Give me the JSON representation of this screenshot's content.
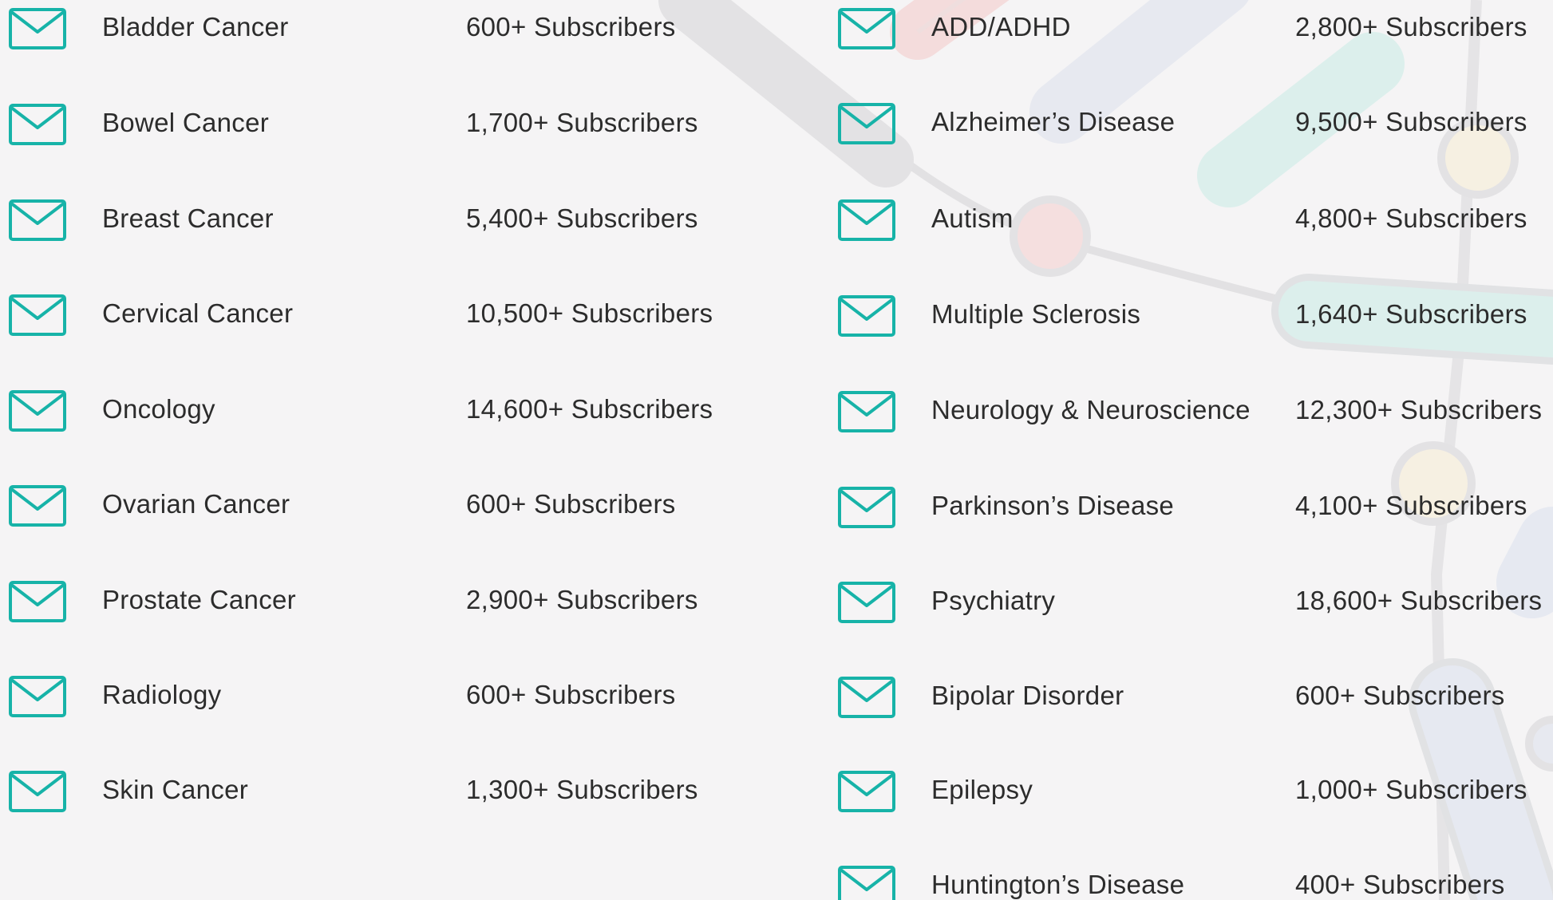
{
  "colors": {
    "background": "#f5f4f5",
    "icon_accent": "#17b3a8",
    "text": "#2c2c2c"
  },
  "icon_name": "envelope-icon",
  "left_column": [
    {
      "topic": "Bladder Cancer",
      "subscribers": "600+ Subscribers"
    },
    {
      "topic": "Bowel Cancer",
      "subscribers": "1,700+ Subscribers"
    },
    {
      "topic": "Breast Cancer",
      "subscribers": "5,400+ Subscribers"
    },
    {
      "topic": "Cervical Cancer",
      "subscribers": "10,500+ Subscribers"
    },
    {
      "topic": "Oncology",
      "subscribers": "14,600+ Subscribers"
    },
    {
      "topic": "Ovarian Cancer",
      "subscribers": "600+ Subscribers"
    },
    {
      "topic": "Prostate Cancer",
      "subscribers": "2,900+ Subscribers"
    },
    {
      "topic": "Radiology",
      "subscribers": "600+ Subscribers"
    },
    {
      "topic": "Skin Cancer",
      "subscribers": "1,300+ Subscribers"
    }
  ],
  "right_column": [
    {
      "topic": "ADD/ADHD",
      "subscribers": "2,800+ Subscribers"
    },
    {
      "topic": "Alzheimer’s Disease",
      "subscribers": "9,500+ Subscribers"
    },
    {
      "topic": "Autism",
      "subscribers": "4,800+ Subscribers"
    },
    {
      "topic": "Multiple Sclerosis",
      "subscribers": "1,640+ Subscribers"
    },
    {
      "topic": "Neurology & Neuroscience",
      "subscribers": "12,300+ Subscribers"
    },
    {
      "topic": "Parkinson’s Disease",
      "subscribers": "4,100+ Subscribers"
    },
    {
      "topic": "Psychiatry",
      "subscribers": "18,600+ Subscribers"
    },
    {
      "topic": "Bipolar Disorder",
      "subscribers": "600+ Subscribers"
    },
    {
      "topic": "Epilepsy",
      "subscribers": "1,000+ Subscribers"
    },
    {
      "topic": "Huntington’s Disease",
      "subscribers": "400+ Subscribers"
    }
  ]
}
